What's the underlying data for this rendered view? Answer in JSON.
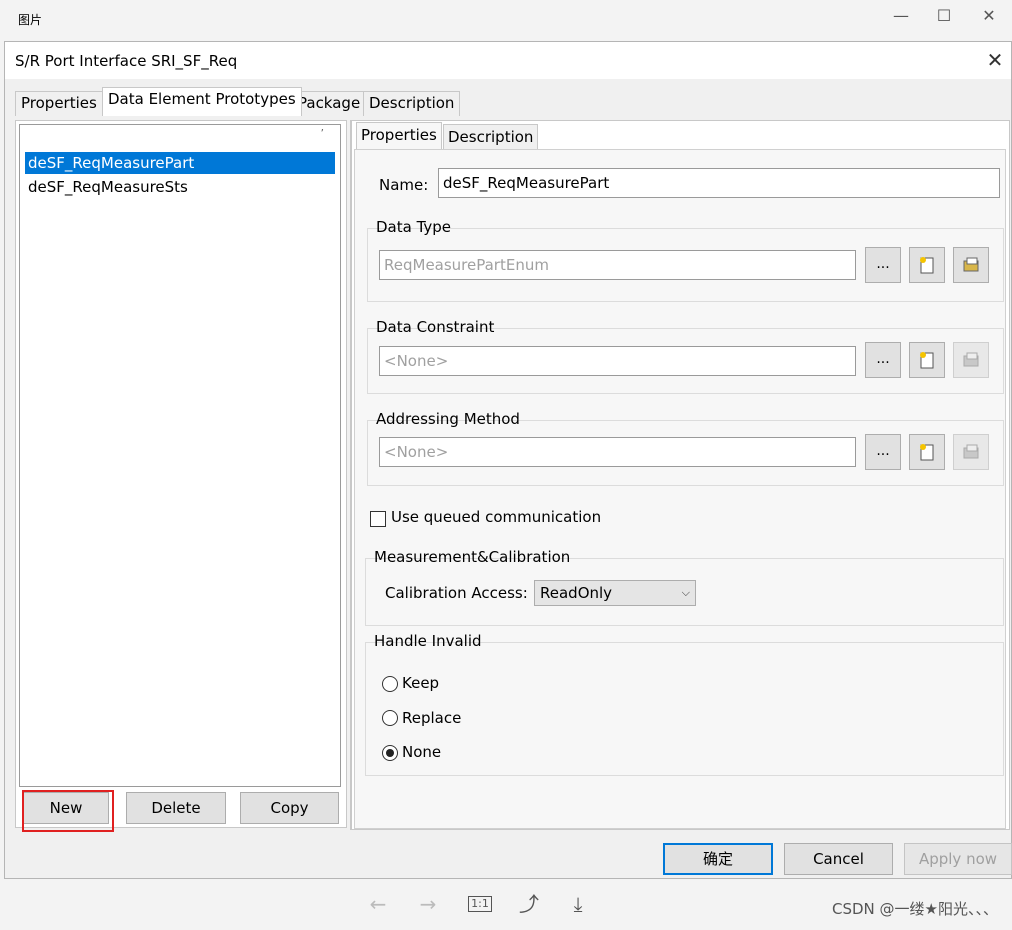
{
  "viewer": {
    "title": "图片",
    "minimize_icon": "minimize-icon",
    "maximize_icon": "maximize-icon",
    "close_icon": "close-icon",
    "toolbar": {
      "actual_size_label": "1:1",
      "watermark": "CSDN @一缕★阳光、、、"
    }
  },
  "dialog": {
    "title": "S/R Port Interface SRI_SF_Req",
    "close_glyph": "✕",
    "tabs": [
      "Properties",
      "Data Element Prototypes",
      "Package",
      "Description"
    ],
    "active_tab": "Data Element Prototypes",
    "list": {
      "items": [
        "deSF_ReqMeasurePart",
        "deSF_ReqMeasureSts"
      ],
      "selected": "deSF_ReqMeasurePart",
      "tick": "ʼ"
    },
    "list_buttons": {
      "new": "New",
      "delete": "Delete",
      "copy": "Copy"
    },
    "detail_tabs": [
      "Properties",
      "Description"
    ],
    "name_label": "Name:",
    "name_value": "deSF_ReqMeasurePart",
    "data_type": {
      "label": "Data Type",
      "value": "ReqMeasurePartEnum"
    },
    "data_constraint": {
      "label": "Data Constraint",
      "value": "<None>"
    },
    "addressing_method": {
      "label": "Addressing Method",
      "value": "<None>"
    },
    "browse_label": "...",
    "use_queued_label": "Use queued communication",
    "use_queued_checked": false,
    "measurement": {
      "label": "Measurement&Calibration",
      "calibration_label": "Calibration Access:",
      "calibration_value": "ReadOnly"
    },
    "handle_invalid": {
      "label": "Handle Invalid",
      "options": [
        "Keep",
        "Replace",
        "None"
      ],
      "selected": "None"
    },
    "footer": {
      "ok": "确定",
      "cancel": "Cancel",
      "apply": "Apply now"
    }
  }
}
